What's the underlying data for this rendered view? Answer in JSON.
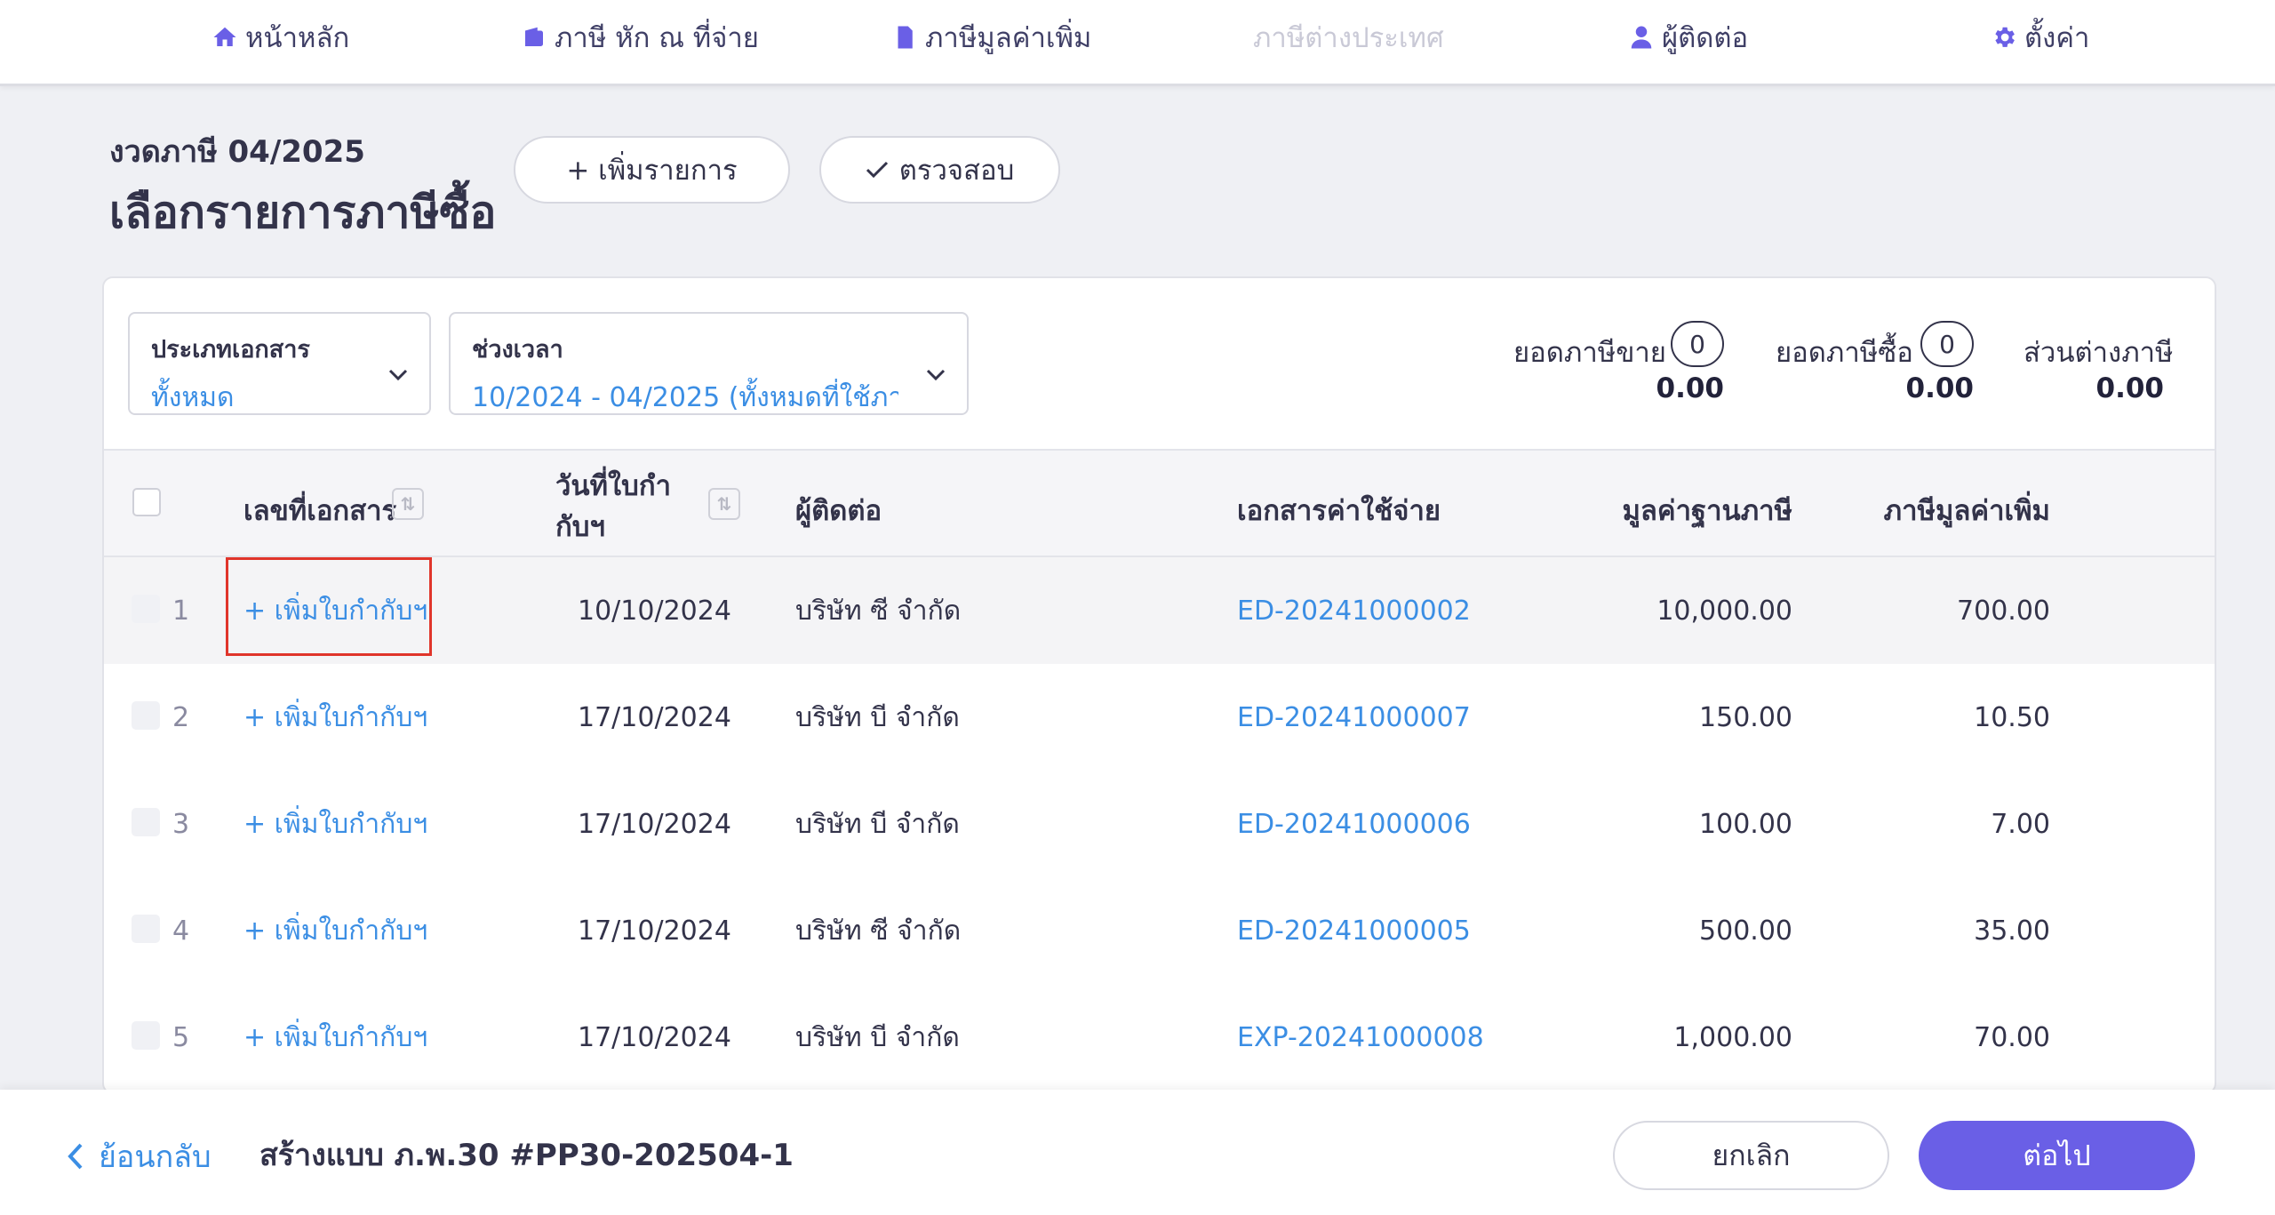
{
  "nav": {
    "items": [
      {
        "label": "หน้าหลัก",
        "icon": "home-icon"
      },
      {
        "label": "ภาษี หัก ณ ที่จ่าย",
        "icon": "wallet-icon"
      },
      {
        "label": "ภาษีมูลค่าเพิ่ม",
        "icon": "document-icon"
      },
      {
        "label": "ภาษีต่างประเทศ",
        "icon": "",
        "disabled": true
      },
      {
        "label": "ผู้ติดต่อ",
        "icon": "person-icon"
      },
      {
        "label": "ตั้งค่า",
        "icon": "gear-icon"
      }
    ]
  },
  "header": {
    "period": "งวดภาษี 04/2025",
    "title": "เลือกรายการภาษีซื้อ",
    "add_button": "+ เพิ่มรายการ",
    "check_button": "ตรวจสอบ"
  },
  "filters": {
    "doc_type": {
      "label": "ประเภทเอกสาร",
      "value": "ทั้งหมด"
    },
    "period": {
      "label": "ช่วงเวลา",
      "value": "10/2024 - 04/2025 (ทั้งหมดที่ใช้ภา..."
    }
  },
  "summary": {
    "sales_tax": {
      "label": "ยอดภาษีขาย",
      "count": "0",
      "value": "0.00"
    },
    "purchase_tax": {
      "label": "ยอดภาษีซื้อ",
      "count": "0",
      "value": "0.00"
    },
    "difference": {
      "label": "ส่วนต่างภาษี",
      "value": "0.00"
    }
  },
  "table": {
    "headers": {
      "doc_no": "เลขที่เอกสาร",
      "date_line1": "วันที่ใบกำ",
      "date_line2": "กับฯ",
      "contact": "ผู้ติดต่อ",
      "expense_doc": "เอกสารค่าใช้จ่าย",
      "tax_base": "มูลค่าฐานภาษี",
      "vat": "ภาษีมูลค่าเพิ่ม"
    },
    "rows": [
      {
        "num": "1",
        "doc": "+ เพิ่มใบกำกับฯ",
        "date": "10/10/2024",
        "contact": "บริษัท ซี จำกัด",
        "expense": "ED-20241000002",
        "base": "10,000.00",
        "vat": "700.00"
      },
      {
        "num": "2",
        "doc": "+ เพิ่มใบกำกับฯ",
        "date": "17/10/2024",
        "contact": "บริษัท บี จำกัด",
        "expense": "ED-20241000007",
        "base": "150.00",
        "vat": "10.50"
      },
      {
        "num": "3",
        "doc": "+ เพิ่มใบกำกับฯ",
        "date": "17/10/2024",
        "contact": "บริษัท บี จำกัด",
        "expense": "ED-20241000006",
        "base": "100.00",
        "vat": "7.00"
      },
      {
        "num": "4",
        "doc": "+ เพิ่มใบกำกับฯ",
        "date": "17/10/2024",
        "contact": "บริษัท ซี จำกัด",
        "expense": "ED-20241000005",
        "base": "500.00",
        "vat": "35.00"
      },
      {
        "num": "5",
        "doc": "+ เพิ่มใบกำกับฯ",
        "date": "17/10/2024",
        "contact": "บริษัท บี จำกัด",
        "expense": "EXP-20241000008",
        "base": "1,000.00",
        "vat": "70.00"
      }
    ]
  },
  "footer": {
    "back": "ย้อนกลับ",
    "doc_name": "สร้างแบบ ภ.พ.30 #PP30-202504-1",
    "cancel": "ยกเลิก",
    "next": "ต่อไป"
  },
  "colors": {
    "accent": "#6a5fe6",
    "link": "#3b8ee4",
    "highlight_border": "#e0352b"
  }
}
